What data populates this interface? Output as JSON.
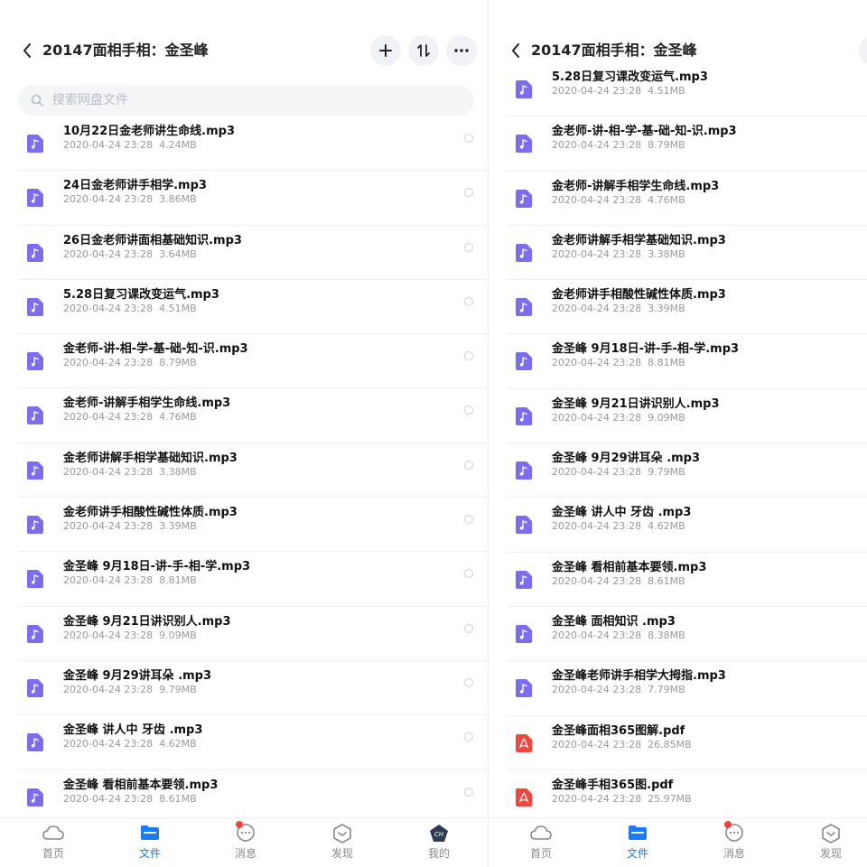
{
  "header": {
    "title": "20147面相手相：金圣峰"
  },
  "search": {
    "placeholder": "搜索网盘文件"
  },
  "left_files": [
    {
      "name": "10月22日金老师讲生命线.mp3",
      "date": "2020-04-24  23:28",
      "size": "4.24MB",
      "type": "audio"
    },
    {
      "name": "24日金老师讲手相学.mp3",
      "date": "2020-04-24  23:28",
      "size": "3.86MB",
      "type": "audio"
    },
    {
      "name": "26日金老师讲面相基础知识.mp3",
      "date": "2020-04-24  23:28",
      "size": "3.64MB",
      "type": "audio"
    },
    {
      "name": "5.28日复习课改变运气.mp3",
      "date": "2020-04-24  23:28",
      "size": "4.51MB",
      "type": "audio"
    },
    {
      "name": "金老师-讲-相-学-基-础-知-识.mp3",
      "date": "2020-04-24  23:28",
      "size": "8.79MB",
      "type": "audio"
    },
    {
      "name": "金老师-讲解手相学生命线.mp3",
      "date": "2020-04-24  23:28",
      "size": "4.76MB",
      "type": "audio"
    },
    {
      "name": "金老师讲解手相学基础知识.mp3",
      "date": "2020-04-24  23:28",
      "size": "3.38MB",
      "type": "audio"
    },
    {
      "name": "金老师讲手相酸性碱性体质.mp3",
      "date": "2020-04-24  23:28",
      "size": "3.39MB",
      "type": "audio"
    },
    {
      "name": "金圣峰 9月18日-讲-手-相-学.mp3",
      "date": "2020-04-24  23:28",
      "size": "8.81MB",
      "type": "audio"
    },
    {
      "name": "金圣峰 9月21日讲识别人.mp3",
      "date": "2020-04-24  23:28",
      "size": "9.09MB",
      "type": "audio"
    },
    {
      "name": "金圣峰 9月29讲耳朵 .mp3",
      "date": "2020-04-24  23:28",
      "size": "9.79MB",
      "type": "audio"
    },
    {
      "name": "金圣峰 讲人中 牙齿 .mp3",
      "date": "2020-04-24  23:28",
      "size": "4.62MB",
      "type": "audio"
    },
    {
      "name": "金圣峰 看相前基本要领.mp3",
      "date": "2020-04-24  23:28",
      "size": "8.61MB",
      "type": "audio"
    }
  ],
  "right_files": [
    {
      "name": "5.28日复习课改变运气.mp3",
      "date": "2020-04-24  23:28",
      "size": "4.51MB",
      "type": "audio"
    },
    {
      "name": "金老师-讲-相-学-基-础-知-识.mp3",
      "date": "2020-04-24  23:28",
      "size": "8.79MB",
      "type": "audio"
    },
    {
      "name": "金老师-讲解手相学生命线.mp3",
      "date": "2020-04-24  23:28",
      "size": "4.76MB",
      "type": "audio"
    },
    {
      "name": "金老师讲解手相学基础知识.mp3",
      "date": "2020-04-24  23:28",
      "size": "3.38MB",
      "type": "audio"
    },
    {
      "name": "金老师讲手相酸性碱性体质.mp3",
      "date": "2020-04-24  23:28",
      "size": "3.39MB",
      "type": "audio"
    },
    {
      "name": "金圣峰 9月18日-讲-手-相-学.mp3",
      "date": "2020-04-24  23:28",
      "size": "8.81MB",
      "type": "audio"
    },
    {
      "name": "金圣峰 9月21日讲识别人.mp3",
      "date": "2020-04-24  23:28",
      "size": "9.09MB",
      "type": "audio"
    },
    {
      "name": "金圣峰 9月29讲耳朵 .mp3",
      "date": "2020-04-24  23:28",
      "size": "9.79MB",
      "type": "audio"
    },
    {
      "name": "金圣峰 讲人中 牙齿 .mp3",
      "date": "2020-04-24  23:28",
      "size": "4.62MB",
      "type": "audio"
    },
    {
      "name": "金圣峰 看相前基本要领.mp3",
      "date": "2020-04-24  23:28",
      "size": "8.61MB",
      "type": "audio"
    },
    {
      "name": "金圣峰 面相知识 .mp3",
      "date": "2020-04-24  23:28",
      "size": "8.38MB",
      "type": "audio"
    },
    {
      "name": "金圣峰老师讲手相学大拇指.mp3",
      "date": "2020-04-24  23:28",
      "size": "7.79MB",
      "type": "audio"
    },
    {
      "name": "金圣峰面相365图解.pdf",
      "date": "2020-04-24  23:28",
      "size": "26.85MB",
      "type": "pdf"
    },
    {
      "name": "金圣峰手相365图.pdf",
      "date": "2020-04-24  23:28",
      "size": "25.97MB",
      "type": "pdf"
    }
  ],
  "tabs": [
    {
      "label": "首页",
      "icon": "cloud-icon"
    },
    {
      "label": "文件",
      "icon": "folder-icon"
    },
    {
      "label": "消息",
      "icon": "chat-icon"
    },
    {
      "label": "发现",
      "icon": "discover-icon"
    },
    {
      "label": "我的",
      "icon": "avatar-icon"
    }
  ],
  "avatar_text": "CH",
  "colors": {
    "accent": "#1e7bf6",
    "audio_icon": "#7b6cf0",
    "pdf_icon": "#f0463d",
    "badge": "#f04141"
  }
}
